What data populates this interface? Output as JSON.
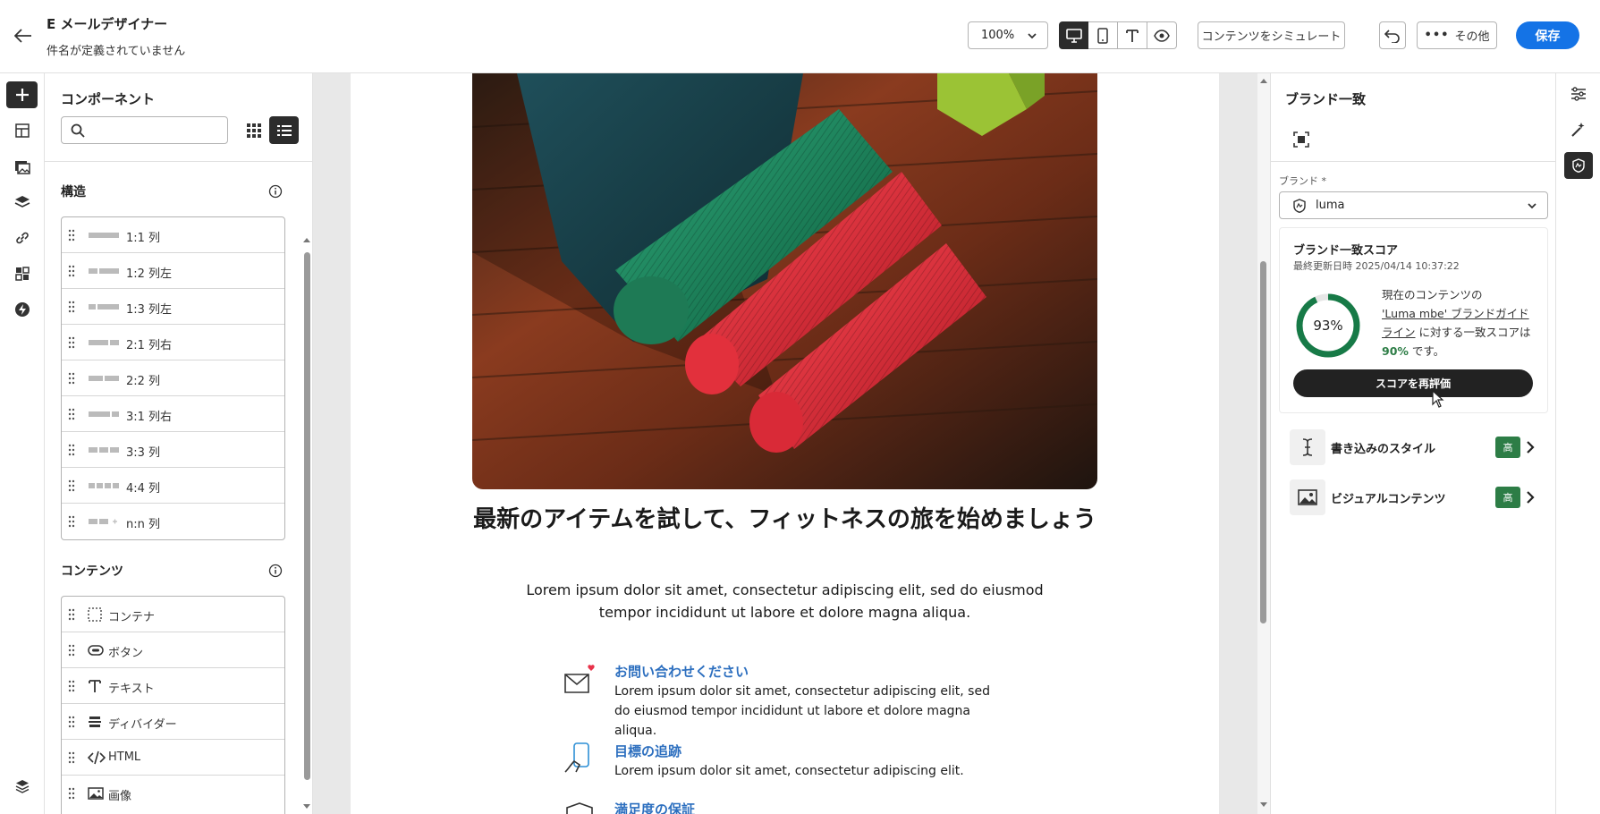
{
  "header": {
    "title": "E メールデザイナー",
    "subtitle": "件名が定義されていません",
    "zoom": "100%",
    "simulate_label": "コンテンツをシミュレート",
    "more_label": "その他",
    "save_label": "保存"
  },
  "components": {
    "title": "コンポーネント",
    "search_placeholder": "",
    "structure_title": "構造",
    "structure_items": [
      {
        "label": "1:1 列"
      },
      {
        "label": "1:2 列左"
      },
      {
        "label": "1:3 列左"
      },
      {
        "label": "2:1 列右"
      },
      {
        "label": "2:2 列"
      },
      {
        "label": "3:1 列右"
      },
      {
        "label": "3:3 列"
      },
      {
        "label": "4:4 列"
      },
      {
        "label": "n:n 列"
      }
    ],
    "content_title": "コンテンツ",
    "content_items": [
      {
        "label": "コンテナ",
        "icon": "container-icon"
      },
      {
        "label": "ボタン",
        "icon": "button-icon"
      },
      {
        "label": "テキスト",
        "icon": "text-icon"
      },
      {
        "label": "ディバイダー",
        "icon": "divider-icon"
      },
      {
        "label": "HTML",
        "icon": "code-icon"
      },
      {
        "label": "画像",
        "icon": "image-icon"
      }
    ]
  },
  "email": {
    "headline": "最新のアイテムを試して、フィットネスの旅を始めましょう",
    "body": "Lorem ipsum dolor sit amet, consectetur adipiscing elit, sed do eiusmod tempor incididunt ut labore et dolore magna aliqua.",
    "features": [
      {
        "title": "お問い合わせください",
        "desc": "Lorem ipsum dolor sit amet, consectetur adipiscing elit, sed do eiusmod tempor incididunt ut labore et dolore magna aliqua.",
        "icon": "mail-heart-icon"
      },
      {
        "title": "目標の追跡",
        "desc": "Lorem ipsum dolor sit amet, consectetur adipiscing elit.",
        "icon": "phone-hand-icon"
      },
      {
        "title": "満足度の保証",
        "desc": "",
        "icon": "shield-icon"
      }
    ]
  },
  "brand_panel": {
    "title": "ブランド一致",
    "brand_label": "ブランド",
    "required_mark": "*",
    "brand_value": "luma",
    "score_title": "ブランド一致スコア",
    "last_updated": "最終更新日時 2025/04/14 10:37:22",
    "score": "93%",
    "score_fraction": 0.93,
    "desc_pre": "現在のコンテンツの",
    "desc_link": "'Luma mbe' ブランドガイドライン",
    "desc_mid": "に対する一致スコアは",
    "desc_pct": "90%",
    "desc_post": "です。",
    "rescore_label": "スコアを再評価",
    "categories": [
      {
        "label": "書き込みのスタイル",
        "badge": "高",
        "icon": "text-cursor-icon"
      },
      {
        "label": "ビジュアルコンテンツ",
        "badge": "高",
        "icon": "image-icon"
      }
    ]
  },
  "colors": {
    "accent": "#1473e6",
    "dark": "#2c2c2c",
    "score_green": "#177a47",
    "badge_green": "#2d7d46",
    "link_blue": "#2d6fbf"
  }
}
